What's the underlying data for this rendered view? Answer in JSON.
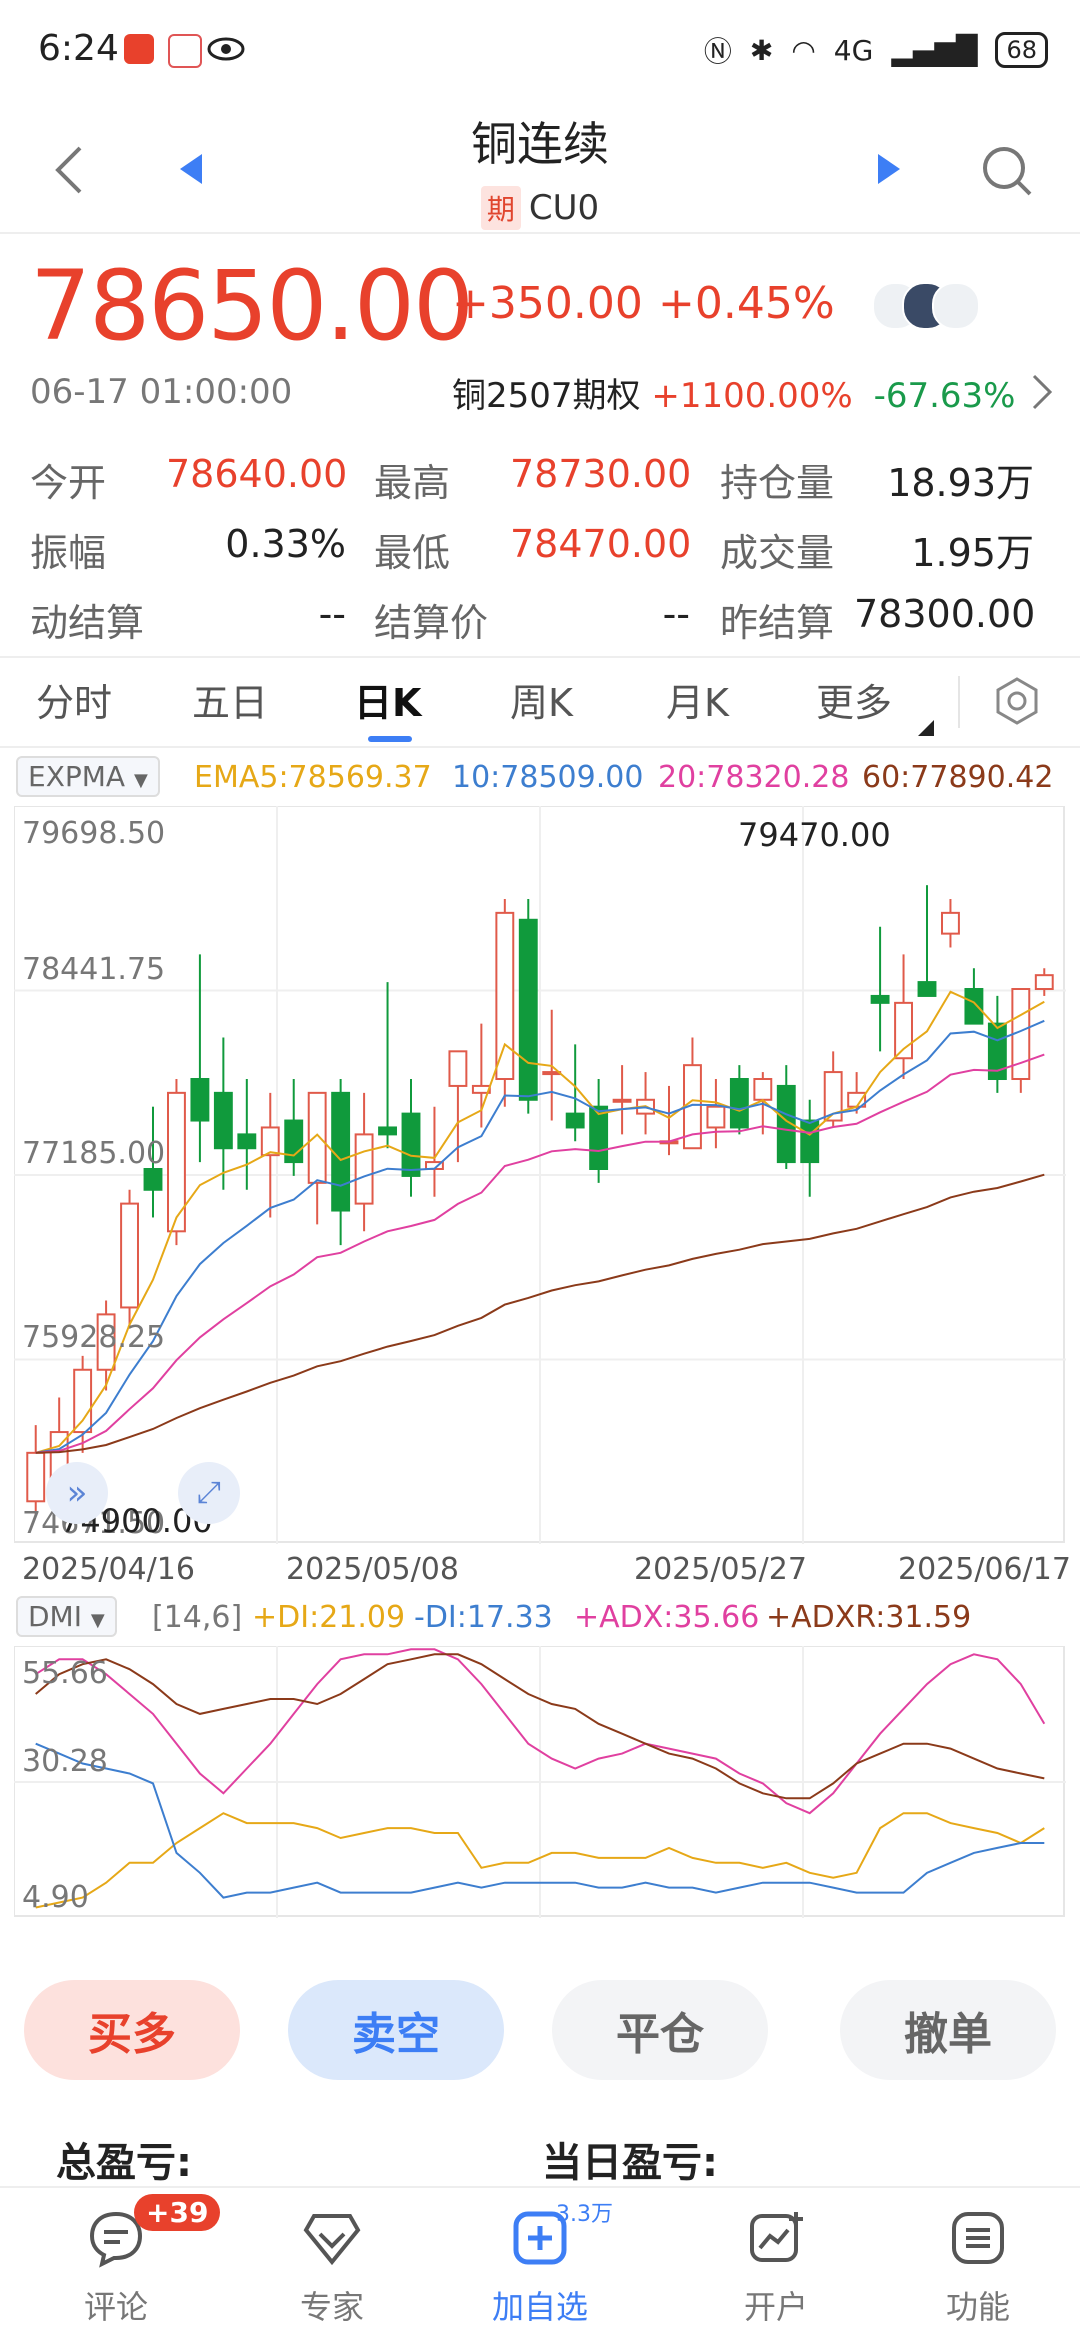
{
  "status_bar": {
    "time": "6:24",
    "network": "4G",
    "battery": "68"
  },
  "nav": {
    "title": "铜连续",
    "tag": "期",
    "code": "CU0"
  },
  "quote": {
    "price": "78650.00",
    "change": "+350.00",
    "change_pct": "+0.45%",
    "time": "06-17 01:00:00",
    "option_name": "铜2507期权",
    "option_up": "+1100.00%",
    "option_down": "-67.63%"
  },
  "stats": [
    {
      "label": "今开",
      "value": "78640.00",
      "color": "red"
    },
    {
      "label": "最高",
      "value": "78730.00",
      "color": "red"
    },
    {
      "label": "持仓量",
      "value": "18.93万",
      "color": "black"
    },
    {
      "label": "振幅",
      "value": "0.33%",
      "color": "black"
    },
    {
      "label": "最低",
      "value": "78470.00",
      "color": "red"
    },
    {
      "label": "成交量",
      "value": "1.95万",
      "color": "black"
    },
    {
      "label": "动结算",
      "value": "--",
      "color": "black"
    },
    {
      "label": "结算价",
      "value": "--",
      "color": "black"
    },
    {
      "label": "昨结算",
      "value": "78300.00",
      "color": "black"
    }
  ],
  "tabs": [
    "分时",
    "五日",
    "日K",
    "周K",
    "月K",
    "更多"
  ],
  "active_tab": "日K",
  "expma": {
    "selector": "EXPMA",
    "ema5": "EMA5:78569.37",
    "ema10": "10:78509.00",
    "ema20": "20:78320.28",
    "ema60": "60:77890.42",
    "colors": {
      "ema5": "#e6a817",
      "ema10": "#3d7ecf",
      "ema20": "#e040a0",
      "ema60": "#8b3a1a"
    }
  },
  "kchart": {
    "y_labels": [
      "79698.50",
      "78441.75",
      "77185.00",
      "75928.25",
      "74671.50"
    ],
    "high_label": "79470.00",
    "low_label": "74900.00",
    "x_labels": [
      "2025/04/16",
      "2025/05/08",
      "2025/05/27",
      "2025/06/17"
    ]
  },
  "dmi": {
    "selector": "DMI",
    "params": "[14,6]",
    "pdi": "+DI:21.09",
    "mdi": "-DI:17.33",
    "adx": "+ADX:35.66",
    "adxr": "+ADXR:31.59",
    "y_labels": [
      "55.66",
      "30.28",
      "4.90"
    ]
  },
  "chart_data": [
    {
      "type": "candlestick",
      "title": "",
      "x_start": "2025/04/16",
      "x_end": "2025/06/17",
      "ylim": [
        74671.5,
        79698.5
      ],
      "candles_ohlc": [
        [
          74850,
          75400,
          74750,
          75200
        ],
        [
          75000,
          75600,
          74800,
          75350
        ],
        [
          75350,
          75900,
          75200,
          75800
        ],
        [
          75800,
          76300,
          75650,
          76200
        ],
        [
          76250,
          77100,
          76100,
          77000
        ],
        [
          77250,
          77700,
          76900,
          77100
        ],
        [
          76800,
          77900,
          76700,
          77800
        ],
        [
          77900,
          78800,
          77300,
          77600
        ],
        [
          77800,
          78200,
          77100,
          77400
        ],
        [
          77500,
          77900,
          77100,
          77400
        ],
        [
          77350,
          77800,
          76900,
          77550
        ],
        [
          77600,
          77900,
          77200,
          77300
        ],
        [
          77150,
          77800,
          76850,
          77800
        ],
        [
          77800,
          77900,
          76700,
          76950
        ],
        [
          77000,
          77800,
          76800,
          77500
        ],
        [
          77550,
          78600,
          77400,
          77500
        ],
        [
          77650,
          77900,
          77050,
          77200
        ],
        [
          77250,
          77700,
          77050,
          77300
        ],
        [
          77850,
          78100,
          77300,
          78100
        ],
        [
          77800,
          78300,
          77550,
          77850
        ],
        [
          77900,
          79200,
          77700,
          79100
        ],
        [
          79050,
          79200,
          77650,
          77750
        ],
        [
          77950,
          78400,
          77600,
          77950
        ],
        [
          77650,
          78150,
          77450,
          77550
        ],
        [
          77700,
          77900,
          77150,
          77250
        ],
        [
          77750,
          78000,
          77500,
          77750
        ],
        [
          77650,
          77950,
          77500,
          77750
        ],
        [
          77450,
          77850,
          77350,
          77450
        ],
        [
          77400,
          78200,
          77400,
          78000
        ],
        [
          77550,
          77900,
          77400,
          77700
        ],
        [
          77900,
          78000,
          77500,
          77550
        ],
        [
          77750,
          77950,
          77500,
          77900
        ],
        [
          77850,
          78000,
          77250,
          77300
        ],
        [
          77600,
          77750,
          77050,
          77300
        ],
        [
          77600,
          78100,
          77550,
          77950
        ],
        [
          77700,
          77950,
          77650,
          77800
        ],
        [
          78500,
          79000,
          78100,
          78450
        ],
        [
          78050,
          78800,
          77900,
          78450
        ],
        [
          78600,
          79300,
          78600,
          78500
        ],
        [
          78950,
          79200,
          78850,
          79100
        ],
        [
          78550,
          78700,
          78300,
          78300
        ],
        [
          78300,
          78500,
          77800,
          77900
        ],
        [
          77900,
          78500,
          77800,
          78550
        ],
        [
          78550,
          78700,
          78500,
          78650
        ]
      ],
      "ema": {
        "EMA5": 78569.37,
        "10": 78509.0,
        "20": 78320.28,
        "60": 77890.42
      },
      "high": 79470.0,
      "low": 74900.0
    },
    {
      "type": "line",
      "title": "",
      "x_start": "2025/04/16",
      "x_end": "2025/06/17",
      "ylim": [
        4.9,
        55.66
      ],
      "series": [
        {
          "name": "+DI",
          "values": [
            5,
            6,
            7,
            10,
            14,
            14,
            18,
            21,
            24,
            22,
            22,
            22,
            21,
            19,
            20,
            21,
            21,
            20,
            20,
            13,
            14,
            14,
            16,
            16,
            15,
            15,
            15,
            17,
            15,
            14,
            14,
            13,
            14,
            12,
            11,
            12,
            21,
            24,
            24,
            22,
            21,
            20,
            18,
            21
          ]
        },
        {
          "name": "-DI",
          "values": [
            38,
            36,
            34,
            33,
            32,
            30,
            16,
            12,
            7,
            8,
            8,
            9,
            10,
            8,
            8,
            8,
            8,
            9,
            10,
            9,
            10,
            10,
            10,
            10,
            9,
            9,
            10,
            9,
            9,
            8,
            9,
            10,
            10,
            10,
            9,
            8,
            8,
            8,
            12,
            14,
            16,
            17,
            18,
            18
          ]
        },
        {
          "name": "+ADX",
          "values": [
            52,
            55,
            55,
            52,
            48,
            44,
            38,
            32,
            28,
            33,
            38,
            44,
            50,
            55,
            56,
            56,
            57,
            57,
            55,
            50,
            44,
            38,
            35,
            33,
            35,
            36,
            38,
            37,
            36,
            35,
            32,
            30,
            26,
            24,
            28,
            34,
            40,
            45,
            50,
            54,
            56,
            55,
            50,
            42
          ]
        },
        {
          "name": "+ADXR",
          "values": [
            48,
            52,
            54,
            55,
            53,
            50,
            46,
            44,
            45,
            46,
            47,
            47,
            46,
            48,
            51,
            54,
            55,
            56,
            56,
            54,
            51,
            48,
            46,
            45,
            42,
            40,
            38,
            36,
            35,
            33,
            30,
            28,
            27,
            27,
            30,
            34,
            36,
            38,
            38,
            37,
            35,
            33,
            32,
            31
          ]
        }
      ]
    }
  ],
  "actions": {
    "buy": "买多",
    "sell": "卖空",
    "close": "平仓",
    "cancel": "撤单"
  },
  "pnl": {
    "total": "总盈亏:",
    "today": "当日盈亏:"
  },
  "bottom_nav": [
    {
      "label": "评论",
      "badge": "+39"
    },
    {
      "label": "专家"
    },
    {
      "label": "加自选",
      "badge": "3.3万"
    },
    {
      "label": "开户"
    },
    {
      "label": "功能"
    }
  ]
}
